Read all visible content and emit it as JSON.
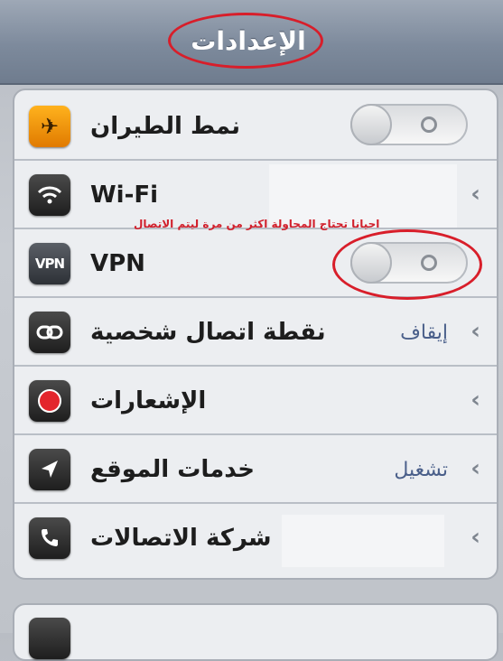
{
  "navbar": {
    "title": "الإعدادات"
  },
  "rows": {
    "airplane": {
      "label": "نمط الطيران",
      "icon": "airplane-icon"
    },
    "wifi": {
      "label": "Wi-Fi",
      "icon": "wifi-icon"
    },
    "vpn": {
      "label": "VPN",
      "icon": "vpn-icon",
      "icon_text": "VPN"
    },
    "hotspot": {
      "label": "نقطة اتصال شخصية",
      "value": "إيقاف",
      "icon": "link-icon"
    },
    "notifications": {
      "label": "الإشعارات",
      "icon": "notifications-icon"
    },
    "location": {
      "label": "خدمات الموقع",
      "value": "تشغيل",
      "icon": "location-arrow-icon"
    },
    "carrier": {
      "label": "شركة الاتصالات",
      "icon": "phone-icon"
    }
  },
  "annotation": {
    "note": "احيانا تحتاج المحاولة اكثر من مرة ليتم الاتصال",
    "color": "#d81e2a"
  },
  "chevron_glyph": "‹"
}
